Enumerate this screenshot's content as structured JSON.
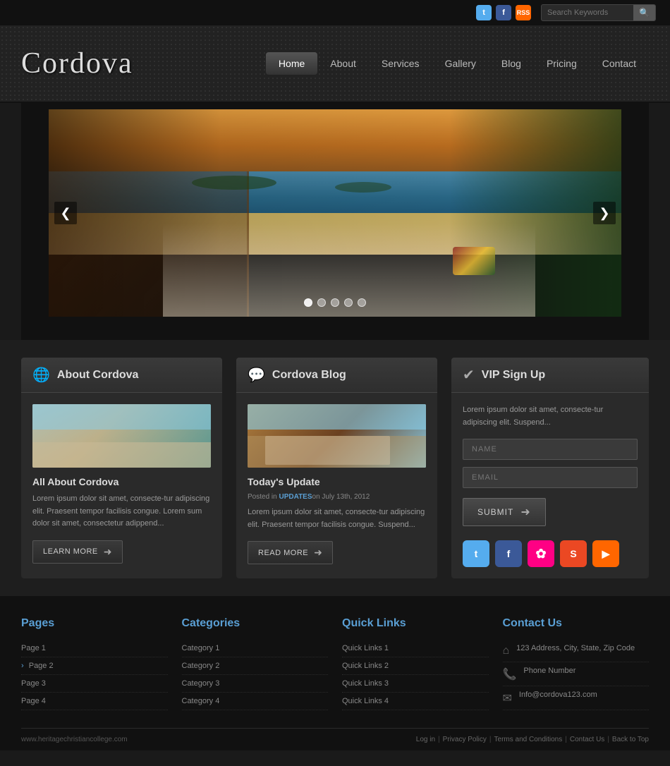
{
  "topbar": {
    "search_placeholder": "Search Keywords",
    "search_button": "🔍",
    "social": [
      {
        "name": "twitter",
        "label": "t",
        "class": "twitter-top"
      },
      {
        "name": "facebook",
        "label": "f",
        "class": "facebook-top"
      },
      {
        "name": "rss",
        "label": "rss",
        "class": "rss-top"
      }
    ]
  },
  "header": {
    "logo": "Cordova",
    "nav": [
      {
        "label": "Home",
        "active": true
      },
      {
        "label": "About",
        "active": false
      },
      {
        "label": "Services",
        "active": false
      },
      {
        "label": "Gallery",
        "active": false
      },
      {
        "label": "Blog",
        "active": false
      },
      {
        "label": "Pricing",
        "active": false
      },
      {
        "label": "Contact",
        "active": false
      }
    ]
  },
  "hero": {
    "prev_label": "❮",
    "next_label": "❯",
    "dots": [
      true,
      false,
      false,
      false,
      false
    ],
    "dot_count": 5
  },
  "about_card": {
    "header_title": "About Cordova",
    "header_icon": "🌐",
    "subtitle": "All About Cordova",
    "text": "Lorem ipsum dolor sit amet, consecte-tur adipiscing elit. Praesent tempor facilisis congue. Lorem sum dolor sit amet, consectetur adippend...",
    "btn_label": "LEARN MORE"
  },
  "blog_card": {
    "header_title": "Cordova Blog",
    "header_icon": "💬",
    "subtitle": "Today's Update",
    "meta_prefix": "Posted in ",
    "meta_tag": "UPDATES",
    "meta_date": "on July 13th, 2012",
    "text": "Lorem ipsum dolor sit amet, consecte-tur adipiscing elit. Praesent tempor facilisis congue. Suspend...",
    "btn_label": "READ MORE"
  },
  "vip_card": {
    "header_title": "VIP Sign Up",
    "header_icon": "✔",
    "intro": "Lorem ipsum dolor sit amet, consecte-tur adipiscing elit. Suspend...",
    "name_placeholder": "NAME",
    "email_placeholder": "EMAIL",
    "submit_label": "SUBMIT",
    "social_icons": [
      {
        "name": "twitter",
        "label": "t",
        "class": "si-twitter"
      },
      {
        "name": "facebook",
        "label": "f",
        "class": "si-facebook"
      },
      {
        "name": "flickr",
        "label": "✿",
        "class": "si-flickr"
      },
      {
        "name": "stumbleupon",
        "label": "S",
        "class": "si-stumble"
      },
      {
        "name": "rss",
        "label": "▶",
        "class": "si-rss"
      }
    ]
  },
  "footer": {
    "pages_title": "Pages",
    "pages": [
      {
        "label": "Page 1",
        "arrow": false
      },
      {
        "label": "Page 2",
        "arrow": true
      },
      {
        "label": "Page 3",
        "arrow": false
      },
      {
        "label": "Page 4",
        "arrow": false
      }
    ],
    "categories_title": "Categories",
    "categories": [
      {
        "label": "Category 1"
      },
      {
        "label": "Category 2"
      },
      {
        "label": "Category 3"
      },
      {
        "label": "Category 4"
      }
    ],
    "quicklinks_title": "Quick Links",
    "quicklinks": [
      {
        "label": "Quick Links 1"
      },
      {
        "label": "Quick Links 2"
      },
      {
        "label": "Quick Links 3"
      },
      {
        "label": "Quick Links 4"
      }
    ],
    "contact_title": "Contact Us",
    "contact_address": "123 Address, City, State, Zip Code",
    "contact_phone": "Phone Number",
    "contact_email": "Info@cordova123.com",
    "bottom_url": "www.heritagechristiancollege.com",
    "bottom_links": [
      "Log in",
      "Privacy Policy",
      "Terms and Conditions",
      "Contact Us",
      "Back to Top"
    ]
  }
}
